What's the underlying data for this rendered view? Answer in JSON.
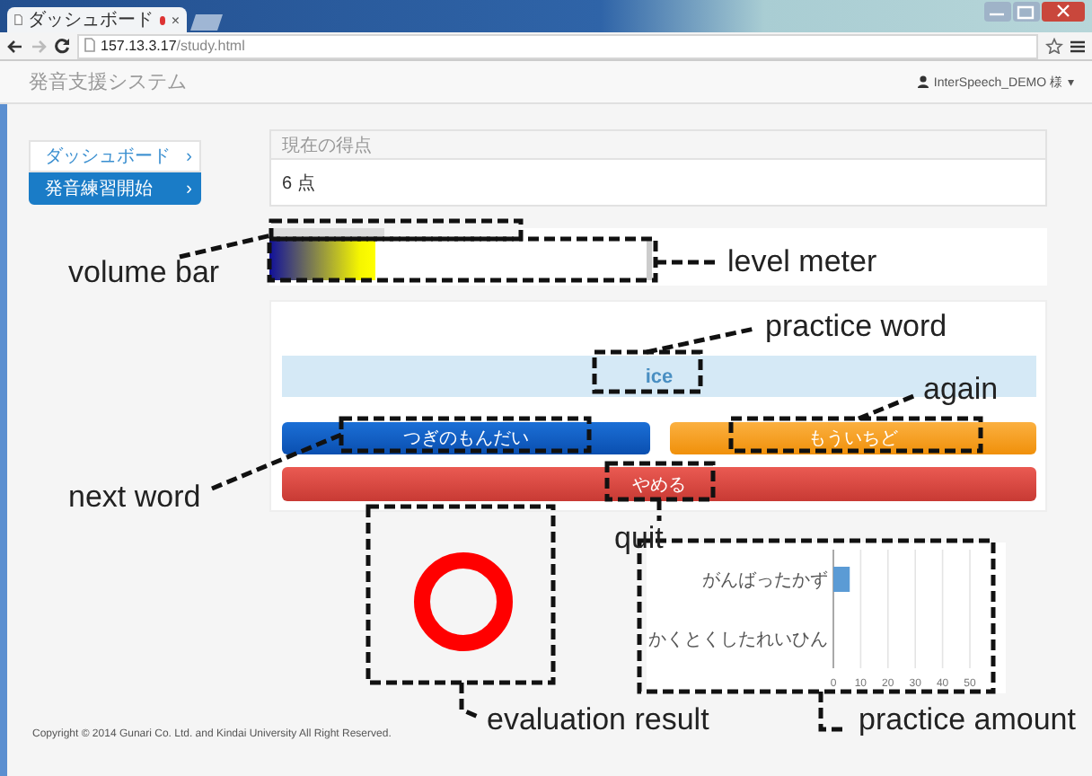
{
  "browser": {
    "tab": {
      "title": "ダッシュボード",
      "close": "×"
    },
    "url": "**157.13.3.17**/study.html"
  },
  "navbar": {
    "brand": "発音支援システム",
    "user": "InterSpeech_DEMO 様",
    "caret": "▾"
  },
  "sidebar": {
    "items": [
      {
        "label": "ダッシュボード",
        "chevron": "›",
        "selected": false
      },
      {
        "label": "発音練習開始",
        "chevron": "›",
        "selected": true
      }
    ]
  },
  "score_panel": {
    "heading": "現在の得点",
    "score": "6 点"
  },
  "volume_bar": {
    "level": 0.46
  },
  "level_meter": {
    "level": 0.28
  },
  "practice": {
    "word": "ice",
    "buttons": [
      {
        "kind": "next",
        "label": "つぎのもんだい"
      },
      {
        "kind": "again",
        "label": "もういちど"
      },
      {
        "kind": "quit",
        "label": "やめる"
      }
    ]
  },
  "evaluation": {
    "correct": true
  },
  "practice_amount": {
    "chart_data": {
      "type": "bar",
      "orientation": "horizontal",
      "categories": [
        "がんばったかず",
        "かくとくしたれいひん"
      ],
      "values": [
        6,
        0
      ],
      "grid": true,
      "xlim": [
        0,
        50
      ],
      "xticks": [
        0,
        10,
        20,
        30,
        40,
        50
      ]
    }
  },
  "footer": {
    "copyright": "Copyright © 2014 Gunari Co. Ltd. and Kindai University All Right Reserved."
  },
  "annotations": [
    {
      "label": "volume bar"
    },
    {
      "label": "level meter"
    },
    {
      "label": "practice word"
    },
    {
      "label": "again"
    },
    {
      "label": "next word"
    },
    {
      "label": "quit"
    },
    {
      "label": "evaluation result"
    },
    {
      "label": "practice amount"
    }
  ]
}
